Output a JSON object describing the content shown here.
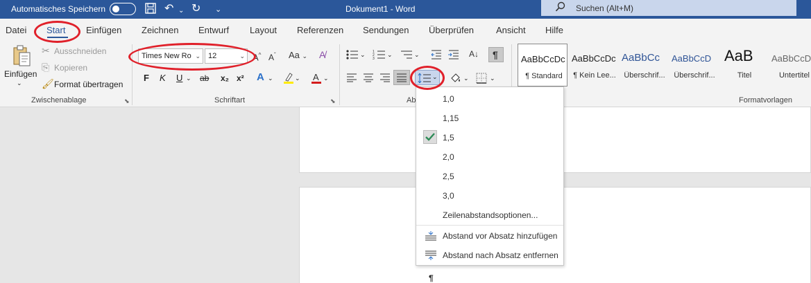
{
  "titlebar": {
    "autosave_label": "Automatisches Speichern",
    "doc_title": "Dokument1  -  Word",
    "search_placeholder": "Suchen (Alt+M)"
  },
  "menu": {
    "tabs": [
      "Datei",
      "Start",
      "Einfügen",
      "Zeichnen",
      "Entwurf",
      "Layout",
      "Referenzen",
      "Sendungen",
      "Überprüfen",
      "Ansicht",
      "Hilfe"
    ],
    "active_tab": "Start"
  },
  "ribbon": {
    "clipboard": {
      "paste_label": "Einfügen",
      "cut_label": "Ausschneiden",
      "copy_label": "Kopieren",
      "format_painter_label": "Format übertragen",
      "group_label": "Zwischenablage"
    },
    "font": {
      "font_name": "Times New Ro",
      "font_size": "12",
      "group_label": "Schriftart",
      "bold": "F",
      "italic": "K",
      "underline": "U",
      "strikethrough": "ab",
      "subscript": "x₂",
      "superscript": "x²",
      "case_label": "Aa"
    },
    "paragraph": {
      "group_label": "Abs"
    },
    "styles": {
      "group_label": "Formatvorlagen",
      "items": [
        {
          "sample": "AaBbCcDc",
          "name": "¶ Standard"
        },
        {
          "sample": "AaBbCcDc",
          "name": "¶ Kein Lee..."
        },
        {
          "sample": "AaBbCc",
          "name": "Überschrif..."
        },
        {
          "sample": "AaBbCcD",
          "name": "Überschrif..."
        },
        {
          "sample": "AaB",
          "name": "Titel"
        },
        {
          "sample": "AaBbCcD",
          "name": "Untertitel"
        }
      ]
    }
  },
  "line_spacing_menu": {
    "options": [
      "1,0",
      "1,15",
      "1,5",
      "2,0",
      "2,5",
      "3,0"
    ],
    "selected": "1,5",
    "more_options": "Zeilenabstandsoptionen...",
    "add_before": "Abstand vor Absatz hinzufügen",
    "remove_after": "Abstand nach Absatz entfernen"
  },
  "document": {
    "pilcrow": "¶"
  },
  "colors": {
    "titlebar": "#2b579a",
    "ribbon_bg": "#f3f3f3",
    "annotation": "#e0202a",
    "check": "#2e8b57"
  },
  "icons": [
    "save-icon",
    "undo-icon",
    "redo-icon",
    "search-icon",
    "paste-icon",
    "scissors-icon",
    "copy-icon",
    "format-painter-icon",
    "grow-font-icon",
    "shrink-font-icon",
    "clear-format-icon",
    "text-effects-icon",
    "highlight-icon",
    "font-color-icon",
    "bullets-icon",
    "numbering-icon",
    "multilevel-icon",
    "decrease-indent-icon",
    "increase-indent-icon",
    "sort-icon",
    "pilcrow-icon",
    "align-left-icon",
    "align-center-icon",
    "align-right-icon",
    "justify-icon",
    "line-spacing-icon",
    "shading-icon",
    "borders-icon",
    "checkmark-icon"
  ]
}
